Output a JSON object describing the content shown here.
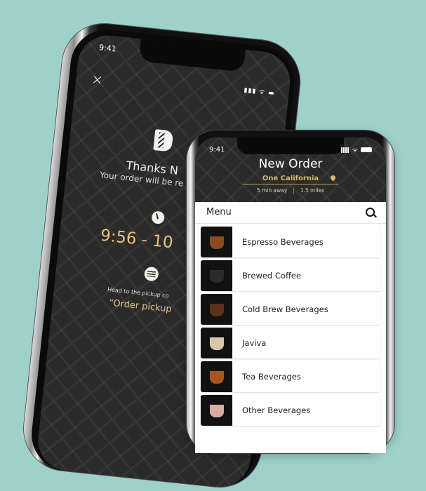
{
  "confirmation_screen": {
    "status_time": "9:41",
    "close_icon": "×",
    "status_icons": "▮▮▮ ᯤ ▬",
    "title": "Thanks N",
    "subtitle": "Your order will be re",
    "pickup_time": "9:56 - 10",
    "instruction": "Head to the pickup co",
    "pickup_label": "“Order pickup"
  },
  "order_screen": {
    "status_time": "9:41",
    "title": "New Order",
    "location": "One California",
    "eta": "5 min away",
    "distance_separator": "|",
    "distance": "1.5 miles",
    "menu_title": "Menu",
    "menu_items": [
      {
        "label": "Espresso Beverages",
        "thumb_color": "#8a4a22"
      },
      {
        "label": "Brewed Coffee",
        "thumb_color": "#2b2b2b"
      },
      {
        "label": "Cold Brew Beverages",
        "thumb_color": "#5a3218"
      },
      {
        "label": "Javiva",
        "thumb_color": "#d8c6a8"
      },
      {
        "label": "Tea Beverages",
        "thumb_color": "#a8561e"
      },
      {
        "label": "Other Beverages",
        "thumb_color": "#d7aea2"
      }
    ]
  },
  "colors": {
    "background": "#9fd1cc",
    "accent_gold": "#d9b867",
    "screen_dark": "#2a2a2a"
  }
}
